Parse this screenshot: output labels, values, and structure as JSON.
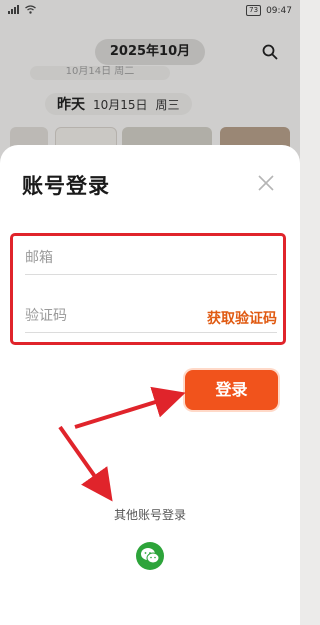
{
  "status_bar": {
    "left_icons": [
      "hd-icon",
      "signal-icon",
      "wifi-icon"
    ],
    "left_text": "HD 4G",
    "battery": "73",
    "time": "09:47"
  },
  "background_app": {
    "month": "2025年10月",
    "faded_date": "10月14日 周二",
    "day_label": "昨天",
    "date": "10月15日",
    "weekday": "周三"
  },
  "login_sheet": {
    "title": "账号登录",
    "email_placeholder": "邮箱",
    "code_placeholder": "验证码",
    "get_code_label": "获取验证码",
    "login_label": "登录",
    "other_login_label": "其他账号登录"
  },
  "colors": {
    "accent": "#f1531c",
    "get_code": "#e05a12",
    "annotation_red": "#e0242b",
    "wechat_green": "#2da43a"
  }
}
